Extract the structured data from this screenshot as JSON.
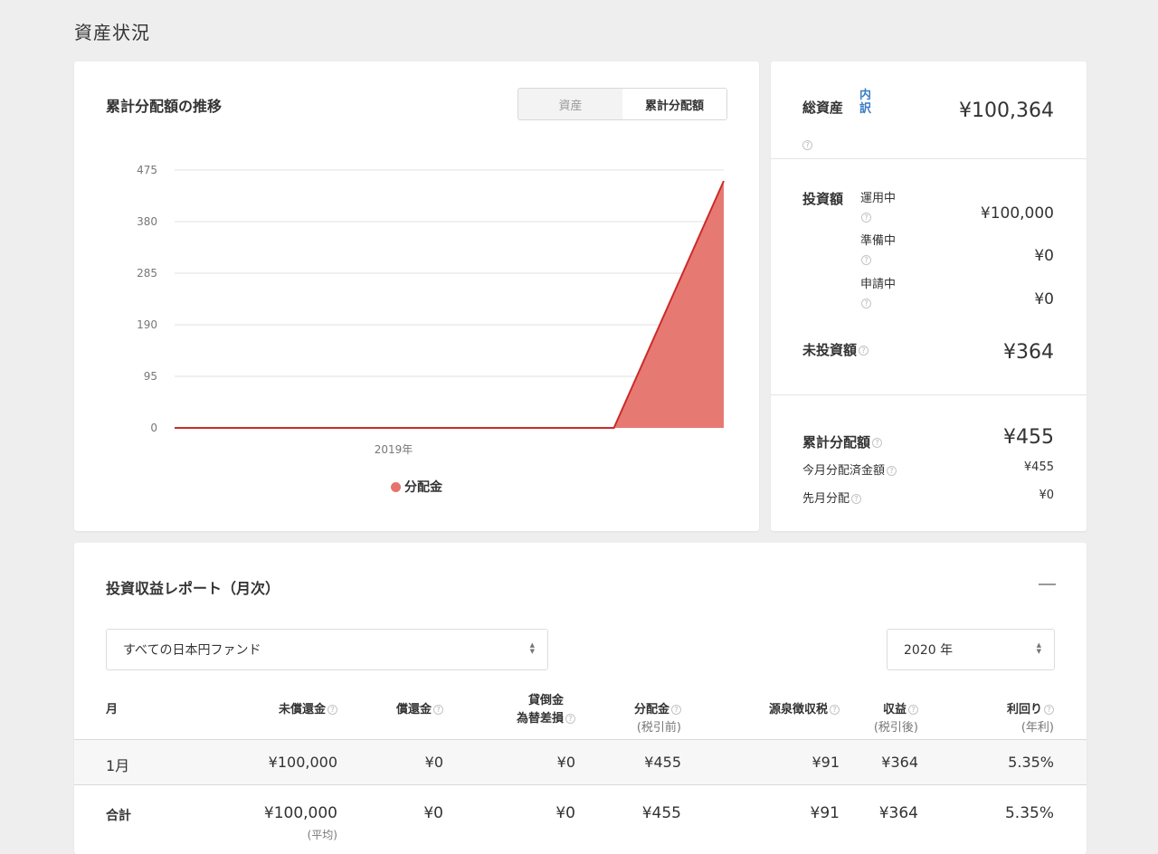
{
  "page_title": "資産状況",
  "chart_card": {
    "title": "累計分配額の推移",
    "toggle": [
      "資産",
      "累計分配額"
    ],
    "legend": "分配金"
  },
  "chart_data": {
    "type": "area",
    "y_ticks": [
      0,
      95,
      190,
      285,
      380,
      475
    ],
    "ylim": [
      0,
      475
    ],
    "x_tick_label": "2019年",
    "series": [
      {
        "name": "分配金",
        "color": "#e5736b",
        "line_color": "#cc2a2a",
        "x": [
          0,
          0.8,
          1
        ],
        "y": [
          0,
          0,
          455
        ]
      }
    ]
  },
  "summary": {
    "total_label": "総資産",
    "breakdown_link": "内訳",
    "total_value": "¥100,364",
    "invest_label": "投資額",
    "invest_items": [
      {
        "label": "運用中",
        "value": "¥100,000"
      },
      {
        "label": "準備中",
        "value": "¥0"
      },
      {
        "label": "申請中",
        "value": "¥0"
      }
    ],
    "uninvested_label": "未投資額",
    "uninvested_value": "¥364",
    "cum_label": "累計分配額",
    "cum_value": "¥455",
    "month_label": "今月分配済金額",
    "month_value": "¥455",
    "last_label": "先月分配",
    "last_value": "¥0",
    "help_glyph": "?"
  },
  "report": {
    "title": "投資収益レポート（月次）",
    "fund_select": "すべての日本円ファンド",
    "year_select": "2020 年",
    "headers": {
      "month": "月",
      "unredeemed": "未償還金",
      "redeemed": "償還金",
      "loss_1": "貸倒金",
      "loss_2": "為替差損",
      "dist": "分配金",
      "dist_sub": "(税引前)",
      "tax": "源泉徴収税",
      "income": "収益",
      "income_sub": "(税引後)",
      "yield": "利回り",
      "yield_sub": "(年利)"
    },
    "rows": [
      {
        "month": "1月",
        "unredeemed": "¥100,000",
        "redeemed": "¥0",
        "loss": "¥0",
        "dist": "¥455",
        "tax": "¥91",
        "income": "¥364",
        "yield": "5.35%"
      }
    ],
    "total": {
      "month": "合計",
      "unredeemed": "¥100,000",
      "unredeemed_sub": "(平均)",
      "redeemed": "¥0",
      "loss": "¥0",
      "dist": "¥455",
      "tax": "¥91",
      "income": "¥364",
      "yield": "5.35%"
    }
  }
}
